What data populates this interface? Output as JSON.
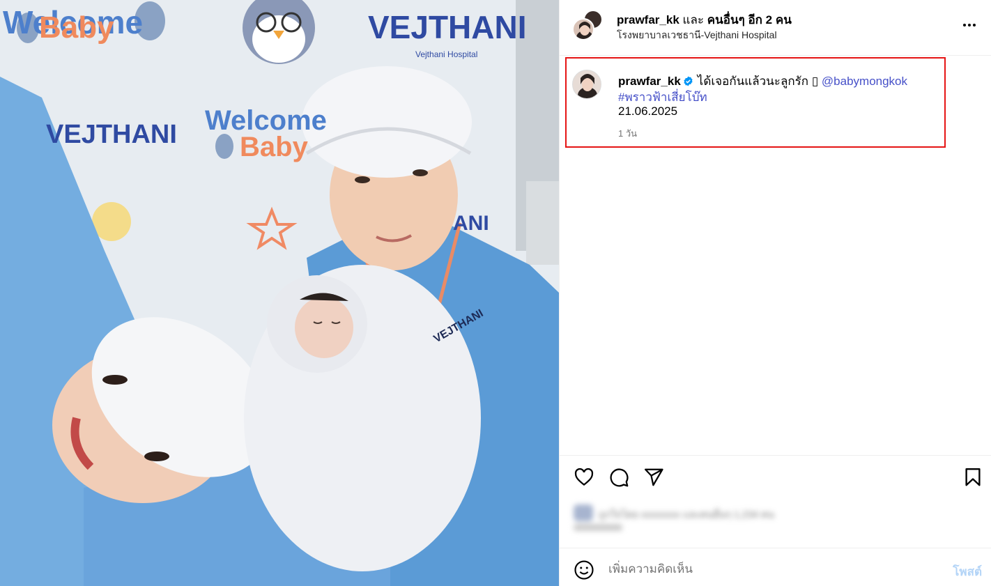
{
  "post": {
    "author": "prawfar_kk",
    "with_connector": "และ",
    "with_others": "คนอื่นๆ อีก 2 คน",
    "location": "โรงพยาบาลเวชธานี-Vejthani Hospital"
  },
  "photo": {
    "banner_logo": "VEJTHANI",
    "banner_logo_sub": "Vejthani Hospital",
    "welcome_text_1": "Welcome",
    "welcome_text_2": "Baby",
    "scrubs_logo": "VEJTHANI",
    "partial_text": "ANI"
  },
  "caption": {
    "username": "prawfar_kk",
    "text": "ได้เจอกันแล้วนะลูกรัก",
    "emoji_placeholder": "▯",
    "mention": "@babymongkok",
    "hashtag": "#พราวฟ้าเสี่ยโบ๊ท",
    "date_text": "21.06.2025",
    "time_ago": "1 วัน"
  },
  "liked_by": {
    "text": "ถูกใจโดย xxxxxxxx และคนอื่นๆ 1,234 คน"
  },
  "comment": {
    "placeholder": "เพิ่มความคิดเห็น",
    "post_label": "โพสต์"
  },
  "icons": {
    "more": "more-horizontal-icon",
    "like": "heart-icon",
    "comment": "comment-bubble-icon",
    "share": "paper-plane-icon",
    "save": "bookmark-icon",
    "emoji": "smiley-icon",
    "verified": "verified-badge-icon"
  },
  "colors": {
    "highlight_border": "#e51414",
    "link": "#4650c8",
    "verified": "#0095f6",
    "post_button_disabled": "#b3d4f7",
    "scrubs_blue": "#5b9bd6"
  }
}
